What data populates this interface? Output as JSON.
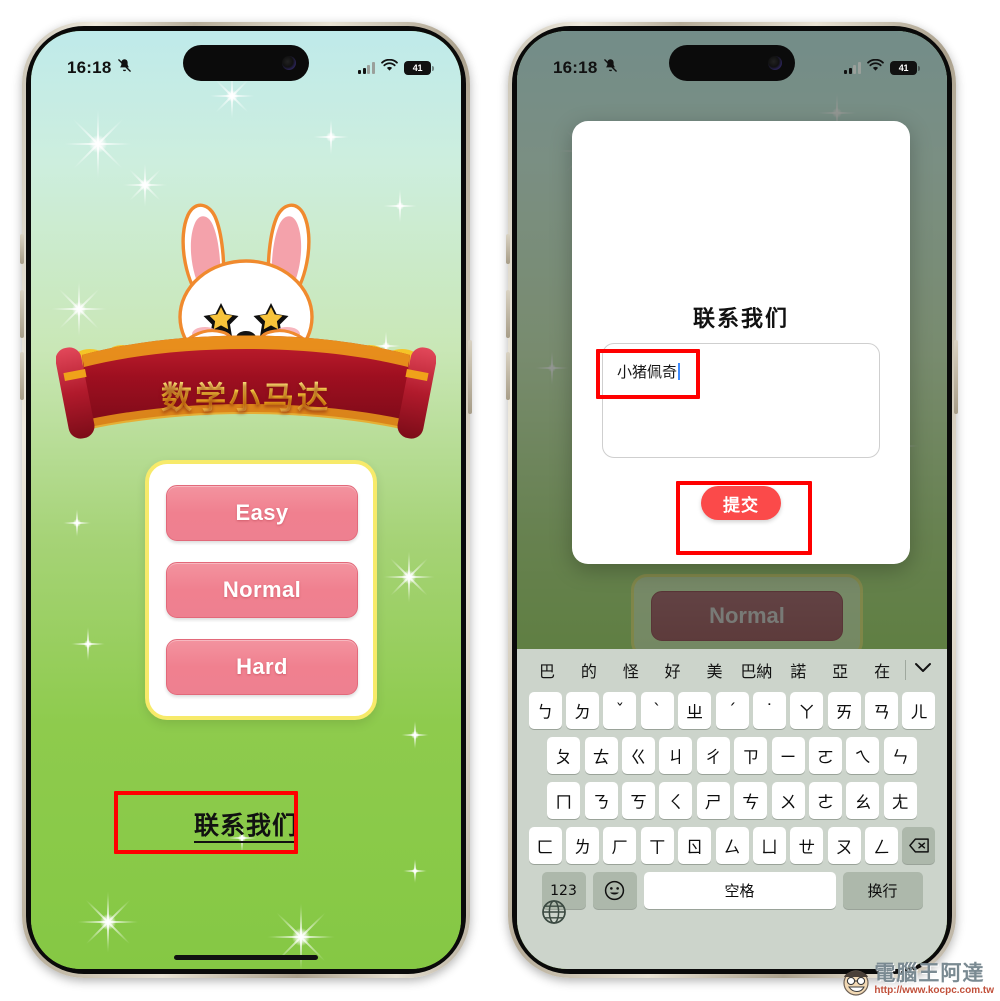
{
  "status_bar": {
    "time": "16:18",
    "mute_icon": "bell-slash-icon",
    "signal_icon": "cellular-bars-icon",
    "wifi_icon": "wifi-icon",
    "battery_level": "41"
  },
  "phone_left": {
    "app_title": "数学小马达",
    "mascot": "rabbit-mascot",
    "difficulty_buttons": [
      {
        "label": "Easy"
      },
      {
        "label": "Normal"
      },
      {
        "label": "Hard"
      }
    ],
    "contact_link": "联系我们"
  },
  "phone_right": {
    "background_button": "Normal",
    "dialog": {
      "title": "联系我们",
      "textarea_value": "小猪佩奇",
      "textarea_placeholder": "",
      "submit_label": "提交"
    },
    "keyboard": {
      "suggestions": [
        "巴",
        "的",
        "怪",
        "好",
        "美",
        "巴納",
        "諾",
        "亞",
        "在"
      ],
      "collapse_icon": "chevron-down-icon",
      "row1": [
        "ㄅ",
        "ㄉ",
        "ˇ",
        "ˋ",
        "ㄓ",
        "ˊ",
        "˙",
        "ㄚ",
        "ㄞ",
        "ㄢ",
        "ㄦ"
      ],
      "row2": [
        "ㄆ",
        "ㄊ",
        "ㄍ",
        "ㄐ",
        "ㄔ",
        "ㄗ",
        "ㄧ",
        "ㄛ",
        "ㄟ",
        "ㄣ"
      ],
      "row3": [
        "ㄇ",
        "ㄋ",
        "ㄎ",
        "ㄑ",
        "ㄕ",
        "ㄘ",
        "ㄨ",
        "ㄜ",
        "ㄠ",
        "ㄤ"
      ],
      "row4": [
        "ㄈ",
        "ㄌ",
        "ㄏ",
        "ㄒ",
        "ㄖ",
        "ㄙ",
        "ㄩ",
        "ㄝ",
        "ㄡ",
        "ㄥ"
      ],
      "backspace_icon": "backspace-icon",
      "numeric_label": "123",
      "emoji_icon": "emoji-icon",
      "space_label": "空格",
      "return_label": "换行",
      "globe_icon": "globe-icon"
    }
  },
  "watermark": {
    "brand": "電腦王阿達",
    "url": "http://www.kocpc.com.tw"
  },
  "colors": {
    "accent_pink": "#f0808f",
    "submit_red": "#fb4a4a",
    "annotation_red": "#ff0000",
    "card_border_yellow": "#f7ea6a",
    "banner_red": "#b0182a",
    "title_gold": "#ffd93f",
    "keyboard_bg": "#ccd4cb"
  }
}
